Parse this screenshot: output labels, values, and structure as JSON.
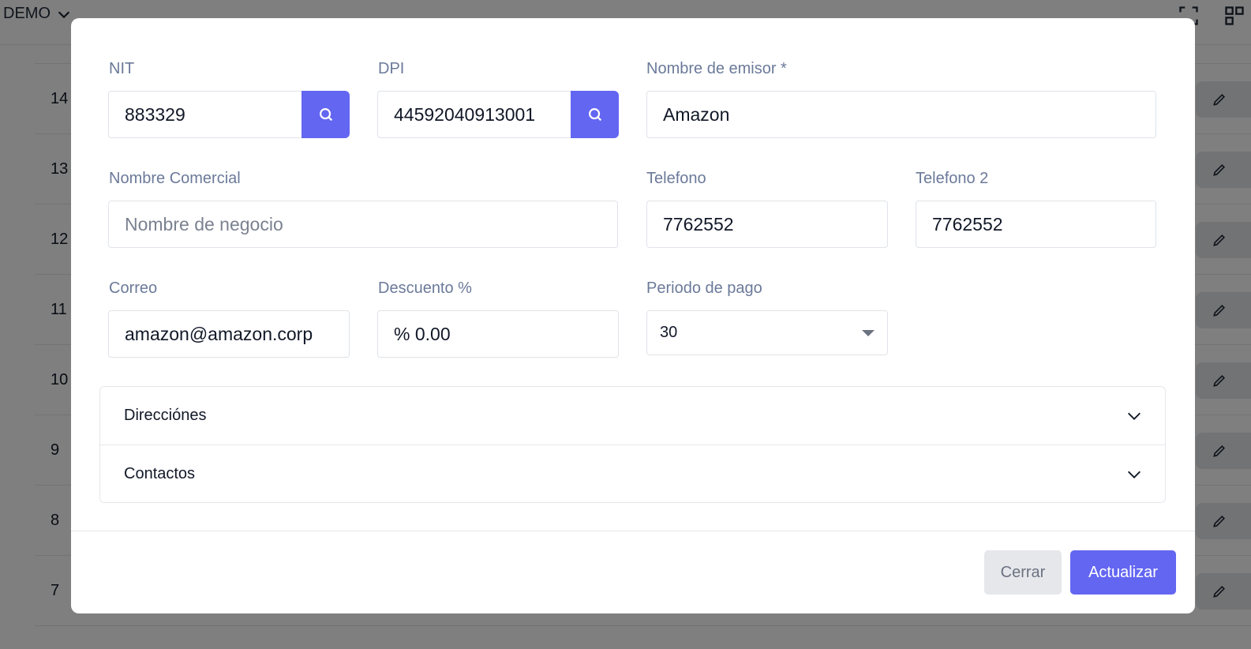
{
  "app": {
    "brand": "DEMO"
  },
  "background_rows": [
    "14",
    "13",
    "12",
    "11",
    "10",
    "9",
    "8",
    "7"
  ],
  "form": {
    "nit": {
      "label": "NIT",
      "value": "883329"
    },
    "dpi": {
      "label": "DPI",
      "value": "44592040913001"
    },
    "nombre_emisor": {
      "label": "Nombre de emisor *",
      "value": "Amazon"
    },
    "nombre_comercial": {
      "label": "Nombre Comercial",
      "value": "",
      "placeholder": "Nombre de negocio"
    },
    "telefono": {
      "label": "Telefono",
      "value": "7762552"
    },
    "telefono2": {
      "label": "Telefono 2",
      "value": "7762552"
    },
    "correo": {
      "label": "Correo",
      "value": "amazon@amazon.corp"
    },
    "descuento": {
      "label": "Descuento %",
      "value": "% 0.00"
    },
    "periodo_pago": {
      "label": "Periodo de pago",
      "value": "30"
    }
  },
  "sections": [
    "Direcciónes",
    "Contactos"
  ],
  "buttons": {
    "close": "Cerrar",
    "update": "Actualizar"
  },
  "colors": {
    "primary": "#6366f1",
    "label": "#6b7a99",
    "overlay": "rgba(0,0,0,0.5)"
  },
  "icons": {
    "search": "search-icon",
    "chevron": "chevron-down-icon",
    "edit": "pencil-icon"
  }
}
